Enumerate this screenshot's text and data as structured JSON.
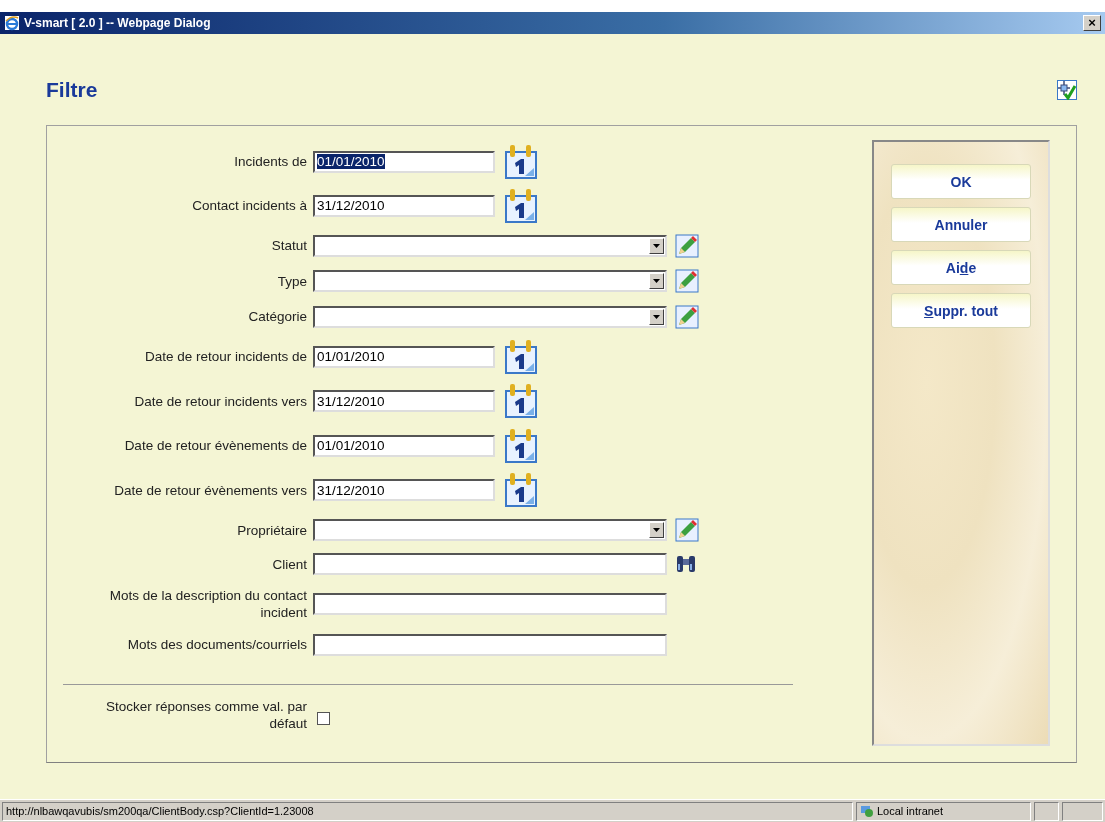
{
  "window": {
    "title": "V-smart [ 2.0 ] -- Webpage Dialog",
    "close": "×"
  },
  "heading": "Filtre",
  "fields": [
    {
      "kind": "date",
      "label": "Incidents de",
      "value": "01/01/2010",
      "highlighted": true
    },
    {
      "kind": "date",
      "label": "Contact incidents à",
      "value": "31/12/2010",
      "highlighted": false
    },
    {
      "kind": "select",
      "label": "Statut"
    },
    {
      "kind": "select",
      "label": "Type"
    },
    {
      "kind": "select",
      "label": "Catégorie"
    },
    {
      "kind": "date",
      "label": "Date de retour incidents de",
      "value": "01/01/2010",
      "highlighted": false
    },
    {
      "kind": "date",
      "label": "Date de retour incidents vers",
      "value": "31/12/2010",
      "highlighted": false
    },
    {
      "kind": "date",
      "label": "Date de retour évènements de",
      "value": "01/01/2010",
      "highlighted": false
    },
    {
      "kind": "date",
      "label": "Date de retour évènements vers",
      "value": "31/12/2010",
      "highlighted": false
    },
    {
      "kind": "select",
      "label": "Propriétaire"
    },
    {
      "kind": "lookup",
      "label": "Client"
    },
    {
      "kind": "text",
      "label": "Mots de la description du contact incident"
    },
    {
      "kind": "text",
      "label": "Mots des documents/courriels"
    }
  ],
  "store_defaults": {
    "label": "Stocker réponses comme val. par défaut",
    "checked": false
  },
  "buttons": [
    {
      "label": "OK"
    },
    {
      "label": "Annuler"
    },
    {
      "before": "Ai",
      "access_key": "d",
      "after": "e"
    },
    {
      "access_key": "S",
      "after": "uppr. tout"
    }
  ],
  "status_bar": {
    "url": "http://nlbawqavubis/sm200qa/ClientBody.csp?ClientId=1.23008",
    "zone": "Local intranet"
  }
}
